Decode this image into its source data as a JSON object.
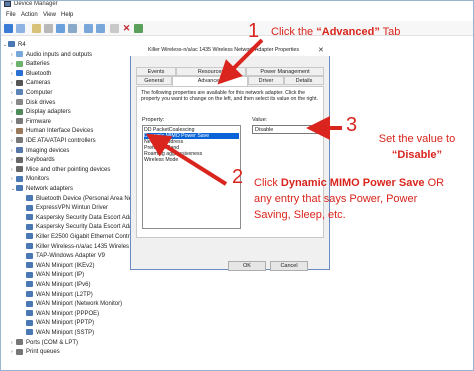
{
  "window": {
    "title": "Device Manager"
  },
  "menu": [
    {
      "label": "File",
      "x": 6
    },
    {
      "label": "Action",
      "x": 21
    },
    {
      "label": "View",
      "x": 43
    },
    {
      "label": "Help",
      "x": 61
    }
  ],
  "tree": {
    "root": "R4",
    "categories": [
      {
        "label": "Audio inputs and outputs",
        "color": "#7aa7d9"
      },
      {
        "label": "Batteries",
        "color": "#6db36d"
      },
      {
        "label": "Bluetooth",
        "color": "#2a6fd4"
      },
      {
        "label": "Cameras",
        "color": "#555"
      },
      {
        "label": "Computer",
        "color": "#5a84b8"
      },
      {
        "label": "Disk drives",
        "color": "#888"
      },
      {
        "label": "Display adapters",
        "color": "#4f8a5a"
      },
      {
        "label": "Firmware",
        "color": "#7a7a7a"
      },
      {
        "label": "Human Interface Devices",
        "color": "#9a7a5a"
      },
      {
        "label": "IDE ATA/ATAPI controllers",
        "color": "#777"
      },
      {
        "label": "Imaging devices",
        "color": "#5577aa"
      },
      {
        "label": "Keyboards",
        "color": "#666"
      },
      {
        "label": "Mice and other pointing devices",
        "color": "#666"
      },
      {
        "label": "Monitors",
        "color": "#4a78b5"
      },
      {
        "label": "Network adapters",
        "color": "#4a78b5"
      }
    ],
    "network_children": [
      "Bluetooth Device (Personal Area Ne",
      "ExpressVPN Wintun Driver",
      "Kaspersky Security Data Escort Ada",
      "Kaspersky Security Data Escort Ada",
      "Killer E2500 Gigabit Ethernet Contr",
      "Killer Wireless-n/a/ac 1435 Wireles",
      "TAP-Windows Adapter V9",
      "WAN Miniport (IKEv2)",
      "WAN Miniport (IP)",
      "WAN Miniport (IPv6)",
      "WAN Miniport (L2TP)",
      "WAN Miniport (Network Monitor)",
      "WAN Miniport (PPPOE)",
      "WAN Miniport (PPTP)",
      "WAN Miniport (SSTP)"
    ],
    "tail_categories": [
      {
        "label": "Ports (COM & LPT)",
        "color": "#777"
      },
      {
        "label": "Print queues",
        "color": "#777"
      }
    ]
  },
  "dialog": {
    "title": "Killer Wireless-n/a/ac 1435 Wireless Network Adapter Properties",
    "tabs_row1": [
      "Events",
      "Resources",
      "Power Management"
    ],
    "tabs_row2": [
      "General",
      "Advanced",
      "Driver",
      "Details"
    ],
    "description": "The following properties are available for this network adapter. Click the property you want to change on the left, and then select its value on the right.",
    "property_label": "Property:",
    "value_label": "Value:",
    "properties": [
      "DD PacketCoalescing",
      "Dynamic MIMO Power Save",
      "Network Address",
      "Preferred Band",
      "Roaming aggressiveness",
      "Wireless Mode"
    ],
    "selected_property": "Dynamic MIMO Power Save",
    "value": "Disable",
    "buttons": [
      "OK",
      "Cancel"
    ]
  },
  "annotations": {
    "step1_num": "1",
    "step1_prefix": "Click the ",
    "step1_strong": "“Advanced”",
    "step1_suffix": " Tab",
    "step2_num": "2",
    "step2_line1_prefix": "Click ",
    "step2_line1_strong": "Dynamic MIMO Power Save",
    "step2_line1_suffix": " OR",
    "step2_line2": "any entry that says Power, Power",
    "step2_line3": "Saving, Sleep, etc.",
    "step3_num": "3",
    "step3_line1": "Set the value to",
    "step3_strong": "“Disable”",
    "color": "#d9251d"
  }
}
